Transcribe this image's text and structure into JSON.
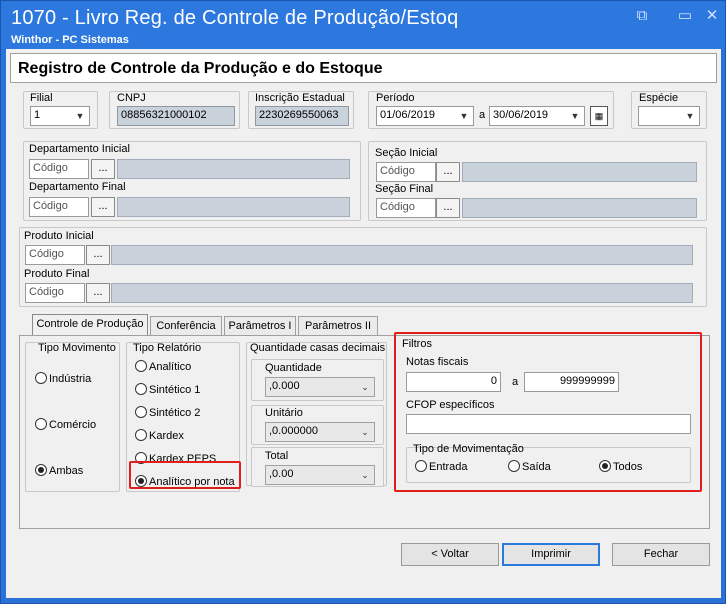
{
  "window": {
    "title": "1070 - Livro Reg. de Controle de Produção/Estoq",
    "subtitle": "Winthor - PC Sistemas",
    "controls": {
      "restore": "⧉",
      "minimize": "▭",
      "close": "✕"
    }
  },
  "header": {
    "title": "Registro de Controle da Produção e do Estoque"
  },
  "filial": {
    "label": "Filial",
    "value": "1"
  },
  "cnpj": {
    "label": "CNPJ",
    "value": "08856321000102"
  },
  "ie": {
    "label": "Inscrição Estadual",
    "value": "2230269550063"
  },
  "periodo": {
    "label": "Período",
    "start": "01/06/2019",
    "sep": "a",
    "end": "30/06/2019"
  },
  "especie": {
    "label": "Espécie",
    "value": ""
  },
  "departamento": {
    "inicial_label": "Departamento Inicial",
    "final_label": "Departamento Final",
    "placeholder": "Código"
  },
  "secao": {
    "inicial_label": "Seção Inicial",
    "final_label": "Seção Final",
    "placeholder": "Código"
  },
  "produto": {
    "inicial_label": "Produto Inicial",
    "final_label": "Produto Final",
    "placeholder": "Código"
  },
  "browse_label": "...",
  "tabs": [
    "Controle de Produção",
    "Conferência",
    "Parâmetros I",
    "Parâmetros II"
  ],
  "tipo_movimento": {
    "label": "Tipo Movimento",
    "options": [
      "Indústria",
      "Comércio",
      "Ambas"
    ],
    "selected": "Ambas"
  },
  "tipo_relatorio": {
    "label": "Tipo Relatório",
    "options": [
      "Analítico",
      "Sintético 1",
      "Sintético 2",
      "Kardex",
      "Kardex PEPS",
      "Analítico por nota"
    ],
    "selected": "Analítico por nota"
  },
  "casas_decimais": {
    "label": "Quantidade casas decimais",
    "quantidade": {
      "label": "Quantidade",
      "value": ",0.000"
    },
    "unitario": {
      "label": "Unitário",
      "value": ",0.000000"
    },
    "total": {
      "label": "Total",
      "value": ",0.00"
    }
  },
  "filtros": {
    "label": "Filtros",
    "notas_label": "Notas fiscais",
    "nota_de": "0",
    "nota_sep": "a",
    "nota_ate": "999999999",
    "cfop_label": "CFOP específicos",
    "cfop_value": "",
    "tipo_mov_label": "Tipo de Movimentação",
    "tipo_mov_options": [
      "Entrada",
      "Saída",
      "Todos"
    ],
    "tipo_mov_selected": "Todos"
  },
  "buttons": {
    "voltar": "< Voltar",
    "imprimir": "Imprimir",
    "fechar": "Fechar"
  },
  "colors": {
    "titlebar": "#2d78de",
    "highlight": "#e01e1e",
    "readonly_field": "#c9d1da"
  }
}
